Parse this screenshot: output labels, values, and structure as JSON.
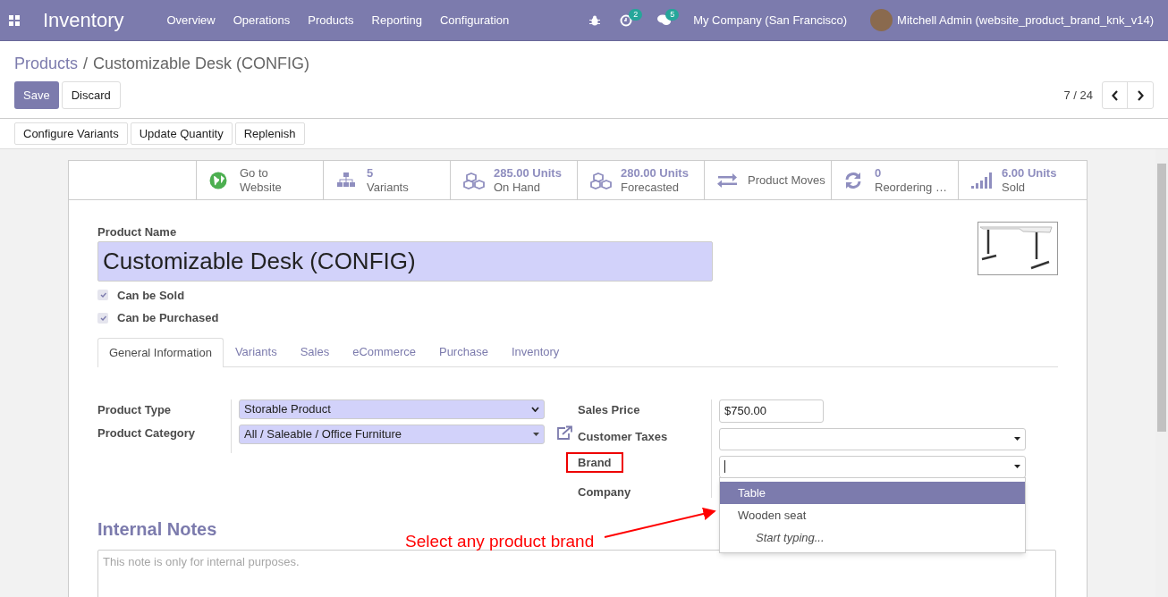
{
  "navbar": {
    "app": "Inventory",
    "menu": [
      "Overview",
      "Operations",
      "Products",
      "Reporting",
      "Configuration"
    ],
    "activity_count": "2",
    "message_count": "5",
    "company": "My Company (San Francisco)",
    "user": "Mitchell Admin (website_product_brand_knk_v14)"
  },
  "breadcrumb": {
    "parent": "Products",
    "separator": "/",
    "current": "Customizable Desk (CONFIG)"
  },
  "buttons": [
    "Save",
    "Discard"
  ],
  "pager": "7 / 24",
  "actions": [
    "Configure Variants",
    "Update Quantity",
    "Replenish"
  ],
  "stats": [
    {
      "kind": "website",
      "label": "Go to",
      "sub": "Website"
    },
    {
      "kind": "variants",
      "value": "5",
      "sub": "Variants"
    },
    {
      "kind": "stock",
      "value": "285.00 Units",
      "sub": "On Hand"
    },
    {
      "kind": "stock",
      "value": "280.00 Units",
      "sub": "Forecasted"
    },
    {
      "kind": "moves",
      "label": "Product Moves"
    },
    {
      "kind": "reordering",
      "value": "0",
      "sub": "Reordering …"
    },
    {
      "kind": "sales",
      "value": "6.00 Units",
      "sub": "Sold"
    }
  ],
  "product_name_label": "Product Name",
  "product_name": "Customizable Desk (CONFIG)",
  "flags": [
    {
      "label": "Can be Sold",
      "checked": true
    },
    {
      "label": "Can be Purchased",
      "checked": true
    }
  ],
  "tabs": [
    {
      "label": "General Information",
      "selected": true
    },
    {
      "label": "Variants",
      "selected": false
    },
    {
      "label": "Sales",
      "selected": false
    },
    {
      "label": "eCommerce",
      "selected": false
    },
    {
      "label": "Purchase",
      "selected": false
    },
    {
      "label": "Inventory",
      "selected": false
    }
  ],
  "left_fields": [
    {
      "label": "Product Type",
      "value": "Storable Product",
      "kind": "select"
    },
    {
      "label": "Product Category",
      "value": "All / Saleable / Office Furniture",
      "kind": "many2one"
    }
  ],
  "right_fields": [
    {
      "label": "Sales Price",
      "value": "$750.00",
      "kind": "input"
    },
    {
      "label": "Customer Taxes",
      "kind": "many2one"
    },
    {
      "label": "Brand",
      "kind": "focused"
    },
    {
      "label": "Company",
      "kind": "hidden"
    }
  ],
  "brand_options": [
    {
      "label": "Table",
      "kind": "option",
      "selected": true
    },
    {
      "label": "Wooden seat",
      "kind": "option",
      "selected": false
    },
    {
      "label": "Start typing...",
      "kind": "hint",
      "selected": false
    }
  ],
  "annotation": "Select any product brand",
  "notes_title": "Internal Notes",
  "notes_placeholder": "This note is only for internal purposes."
}
